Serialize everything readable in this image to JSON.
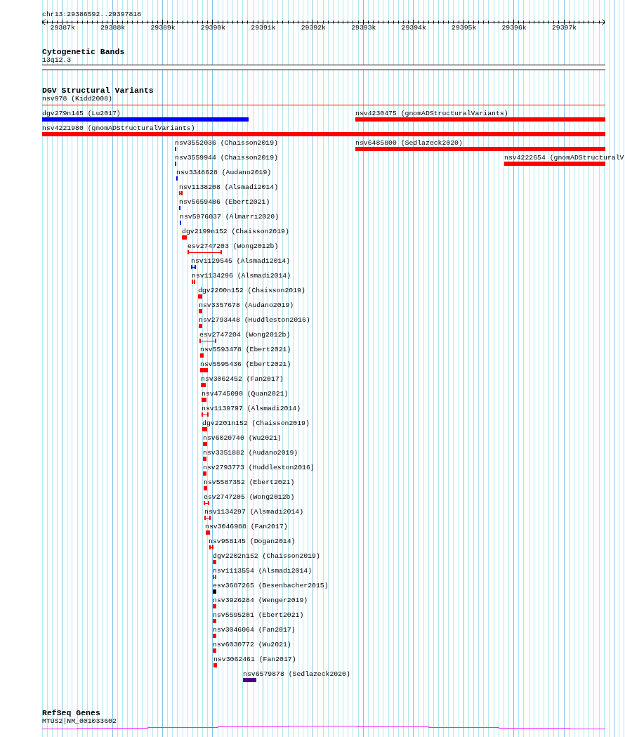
{
  "ruler": {
    "region": "chr13:29386592..29397818",
    "ticks": [
      "29387k",
      "29388k",
      "29389k",
      "29390k",
      "29391k",
      "29392k",
      "29393k",
      "29394k",
      "29395k",
      "29396k",
      "29397k"
    ]
  },
  "tracks": [
    {
      "kind": "cytoband",
      "title": "Cytogenetic Bands",
      "band": "13q12.3"
    },
    {
      "kind": "variants",
      "title": "DGV Structural Variants",
      "rows": [
        {
          "features": [
            {
              "label": "nsv978 (Kidd2008)",
              "kind": "span",
              "color": "#ff0000"
            }
          ]
        },
        {
          "features": [
            {
              "label": "dgv279n145 (Lu2017)",
              "kind": "block",
              "color": "#0000ff"
            },
            {
              "label": "nsv4230475 (gnomADStructuralVariants)",
              "kind": "block",
              "color": "#ff0000"
            }
          ]
        },
        {
          "features": [
            {
              "label": "nsv4221980 (gnomADStructuralVariants)",
              "kind": "block",
              "color": "#ff0000"
            }
          ]
        },
        {
          "features": [
            {
              "label": "nsv3552036 (Chaisson2019)",
              "kind": "block",
              "color": "#0000ff"
            },
            {
              "label": "nsv6485800 (Sedlazeck2020)",
              "kind": "block",
              "color": "#ff0000"
            }
          ]
        },
        {
          "features": [
            {
              "label": "nsv3559944 (Chaisson2019)",
              "kind": "block",
              "color": "#0000ff"
            },
            {
              "label": "nsv4222654 (gnomADStructuralV",
              "kind": "block",
              "color": "#ff0000"
            }
          ]
        },
        {
          "features": [
            {
              "label": "nsv3348628 (Audano2019)",
              "kind": "block",
              "color": "#0000ff"
            }
          ]
        },
        {
          "features": [
            {
              "label": "nsv1138208 (Alsmadi2014)",
              "kind": "span",
              "color": "#ff0000"
            }
          ]
        },
        {
          "features": [
            {
              "label": "nsv5659486 (Ebert2021)",
              "kind": "block",
              "color": "#0000ff"
            }
          ]
        },
        {
          "features": [
            {
              "label": "nsv5976037 (Almarri2020)",
              "kind": "block",
              "color": "#0000ff"
            }
          ]
        },
        {
          "features": [
            {
              "label": "dgv2199n152 (Chaisson2019)",
              "kind": "block",
              "color": "#ff0000"
            }
          ]
        },
        {
          "features": [
            {
              "label": "esv2747203 (Wong2012b)",
              "kind": "span",
              "color": "#ff0000"
            }
          ]
        },
        {
          "features": [
            {
              "label": "nsv1129545 (Alsmadi2014)",
              "kind": "span",
              "color": "#0000ff"
            }
          ]
        },
        {
          "features": [
            {
              "label": "nsv1134296 (Alsmadi2014)",
              "kind": "span",
              "color": "#ff0000"
            }
          ]
        },
        {
          "features": [
            {
              "label": "dgv2200n152 (Chaisson2019)",
              "kind": "block",
              "color": "#ff0000"
            }
          ]
        },
        {
          "features": [
            {
              "label": "nsv3357678 (Audano2019)",
              "kind": "block",
              "color": "#ff0000"
            }
          ]
        },
        {
          "features": [
            {
              "label": "nsv2793448 (Huddleston2016)",
              "kind": "block",
              "color": "#ff0000"
            }
          ]
        },
        {
          "features": [
            {
              "label": "esv2747204 (Wong2012b)",
              "kind": "span",
              "color": "#ff0000"
            }
          ]
        },
        {
          "features": [
            {
              "label": "nsv5593478 (Ebert2021)",
              "kind": "block",
              "color": "#ff0000"
            }
          ]
        },
        {
          "features": [
            {
              "label": "nsv5595436 (Ebert2021)",
              "kind": "block",
              "color": "#ff0000"
            }
          ]
        },
        {
          "features": [
            {
              "label": "nsv3062452 (Fan2017)",
              "kind": "block",
              "color": "#ff0000"
            }
          ]
        },
        {
          "features": [
            {
              "label": "nsv4745090 (Quan2021)",
              "kind": "block",
              "color": "#ff0000"
            }
          ]
        },
        {
          "features": [
            {
              "label": "nsv1139797 (Alsmadi2014)",
              "kind": "span",
              "color": "#ff0000"
            }
          ]
        },
        {
          "features": [
            {
              "label": "dgv2201n152 (Chaisson2019)",
              "kind": "block",
              "color": "#ff0000"
            }
          ]
        },
        {
          "features": [
            {
              "label": "nsv6020740 (Wu2021)",
              "kind": "block",
              "color": "#ff0000"
            }
          ]
        },
        {
          "features": [
            {
              "label": "nsv3351882 (Audano2019)",
              "kind": "block",
              "color": "#ff0000"
            }
          ]
        },
        {
          "features": [
            {
              "label": "nsv2793773 (Huddleston2016)",
              "kind": "block",
              "color": "#ff0000"
            }
          ]
        },
        {
          "features": [
            {
              "label": "nsv5587352 (Ebert2021)",
              "kind": "block",
              "color": "#ff0000"
            }
          ]
        },
        {
          "features": [
            {
              "label": "esv2747205 (Wong2012b)",
              "kind": "span",
              "color": "#ff0000"
            }
          ]
        },
        {
          "features": [
            {
              "label": "nsv1134297 (Alsmadi2014)",
              "kind": "span",
              "color": "#ff0000"
            }
          ]
        },
        {
          "features": [
            {
              "label": "nsv3046988 (Fan2017)",
              "kind": "block",
              "color": "#ff0000"
            }
          ]
        },
        {
          "features": [
            {
              "label": "nsv958145 (Dogan2014)",
              "kind": "span",
              "color": "#ff0000"
            }
          ]
        },
        {
          "features": [
            {
              "label": "dgv2202n152 (Chaisson2019)",
              "kind": "block",
              "color": "#ff0000"
            }
          ]
        },
        {
          "features": [
            {
              "label": "nsv1113554 (Alsmadi2014)",
              "kind": "span",
              "color": "#ff0000"
            }
          ]
        },
        {
          "features": [
            {
              "label": "esv3687265 (Besenbacher2015)",
              "kind": "block",
              "color": "#000000"
            }
          ]
        },
        {
          "features": [
            {
              "label": "nsv3926284 (Wenger2019)",
              "kind": "block",
              "color": "#ff0000"
            }
          ]
        },
        {
          "features": [
            {
              "label": "nsv5595201 (Ebert2021)",
              "kind": "block",
              "color": "#ff0000"
            }
          ]
        },
        {
          "features": [
            {
              "label": "nsv3046064 (Fan2017)",
              "kind": "block",
              "color": "#ff0000"
            }
          ]
        },
        {
          "features": [
            {
              "label": "nsv6030772 (Wu2021)",
              "kind": "block",
              "color": "#ff0000"
            }
          ]
        },
        {
          "features": [
            {
              "label": "nsv3062461 (Fan2017)",
              "kind": "block",
              "color": "#ff0000"
            }
          ]
        },
        {
          "features": [
            {
              "label": "nsv6579878 (Sedlazeck2020)",
              "kind": "block",
              "color": "#4b0082"
            }
          ]
        }
      ]
    },
    {
      "kind": "genes",
      "title": "RefSeq Genes",
      "gene": "MTUS2|NM_001033602"
    }
  ]
}
